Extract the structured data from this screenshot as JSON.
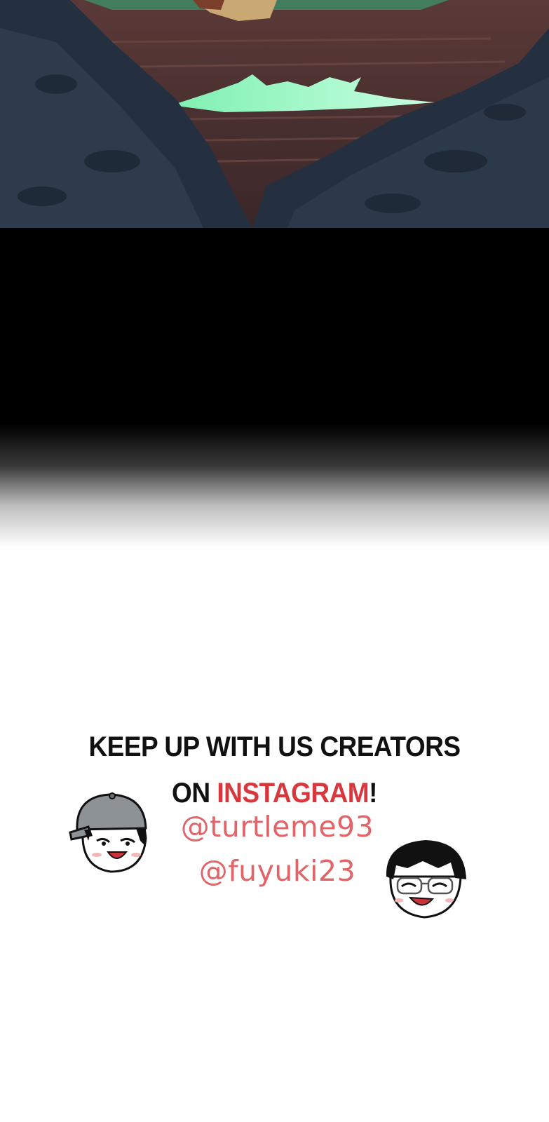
{
  "promo": {
    "line_1": "KEEP UP WITH US CREATORS",
    "line_2_prefix": "ON ",
    "line_2_highlight": "INSTAGRAM",
    "line_2_suffix": "!",
    "handles": [
      "@turtleme93",
      "@fuyuki23"
    ]
  },
  "colors": {
    "accent_red": "#d8383d",
    "handle_pink": "#e06468",
    "headline": "#111111"
  },
  "icons": [
    "creator-avatar-cap-icon",
    "creator-avatar-glasses-icon"
  ]
}
